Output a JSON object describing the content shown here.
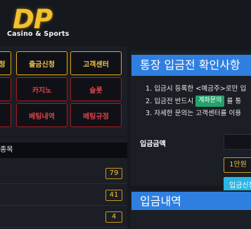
{
  "logo": {
    "main": "DP",
    "sub": "Casino & Sports"
  },
  "nav": {
    "row1": [
      "청",
      "출금신청",
      "고객센터"
    ],
    "row2": [
      "",
      "카지노",
      "슬롯"
    ],
    "row3": [
      "",
      "베팅내역",
      "베팅규정"
    ]
  },
  "bet_list": {
    "header": "종목",
    "counts": [
      "79",
      "41",
      "4"
    ]
  },
  "notice": {
    "title": "통장 입금전 확인사항",
    "line1": "1. 입금시 등록한 <예금주>로만 입",
    "line2_pre": "2. 입금전 반드시",
    "line2_badge": "계좌문의",
    "line2_post": "를 통",
    "line3": "3. 자세한 문의는 고객센터를 이용"
  },
  "deposit": {
    "amount_label": "입금금액",
    "btn_10k": "1만원",
    "submit": "입금신청"
  },
  "history": {
    "title": "입금내역"
  },
  "colors": {
    "gold": "#e5a712",
    "red": "#a11b22",
    "blue": "#2f7fe0",
    "cyan": "#2bb6e6",
    "green": "#22a36b"
  }
}
